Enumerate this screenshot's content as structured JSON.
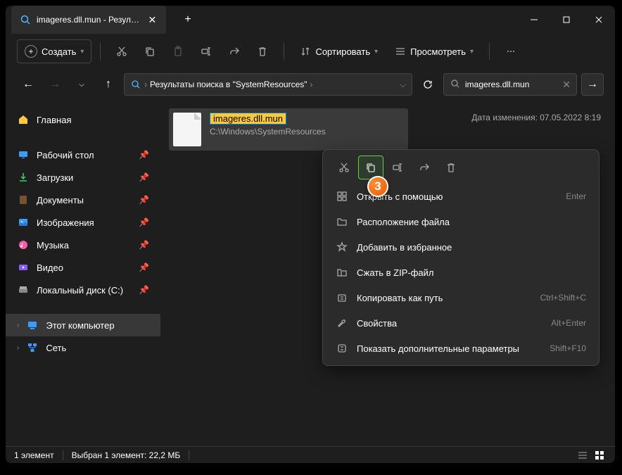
{
  "titlebar": {
    "tab_title": "imageres.dll.mun - Результат"
  },
  "toolbar": {
    "new_label": "Создать",
    "sort_label": "Сортировать",
    "view_label": "Просмотреть"
  },
  "breadcrumb": {
    "text": "Результаты поиска в \"SystemResources\""
  },
  "search": {
    "value": "imageres.dll.mun"
  },
  "sidebar": {
    "home": "Главная",
    "desktop": "Рабочий стол",
    "downloads": "Загрузки",
    "documents": "Документы",
    "pictures": "Изображения",
    "music": "Музыка",
    "videos": "Видео",
    "local_disk": "Локальный диск (C:)",
    "this_pc": "Этот компьютер",
    "network": "Сеть"
  },
  "file": {
    "name": "imageres.dll.mun",
    "path": "C:\\Windows\\SystemResources",
    "date_label": "Дата изменения:",
    "date_value": "07.05.2022 8:19"
  },
  "context_menu": {
    "open_with": "Открыть с помощью",
    "open_with_shortcut": "Enter",
    "file_location": "Расположение файла",
    "add_fav": "Добавить в избранное",
    "compress": "Сжать в ZIP-файл",
    "copy_path": "Копировать как путь",
    "copy_path_shortcut": "Ctrl+Shift+C",
    "properties": "Свойства",
    "properties_shortcut": "Alt+Enter",
    "show_more": "Показать дополнительные параметры",
    "show_more_shortcut": "Shift+F10"
  },
  "badge": "3",
  "statusbar": {
    "count": "1 элемент",
    "selected": "Выбран 1 элемент: 22,2 МБ"
  }
}
